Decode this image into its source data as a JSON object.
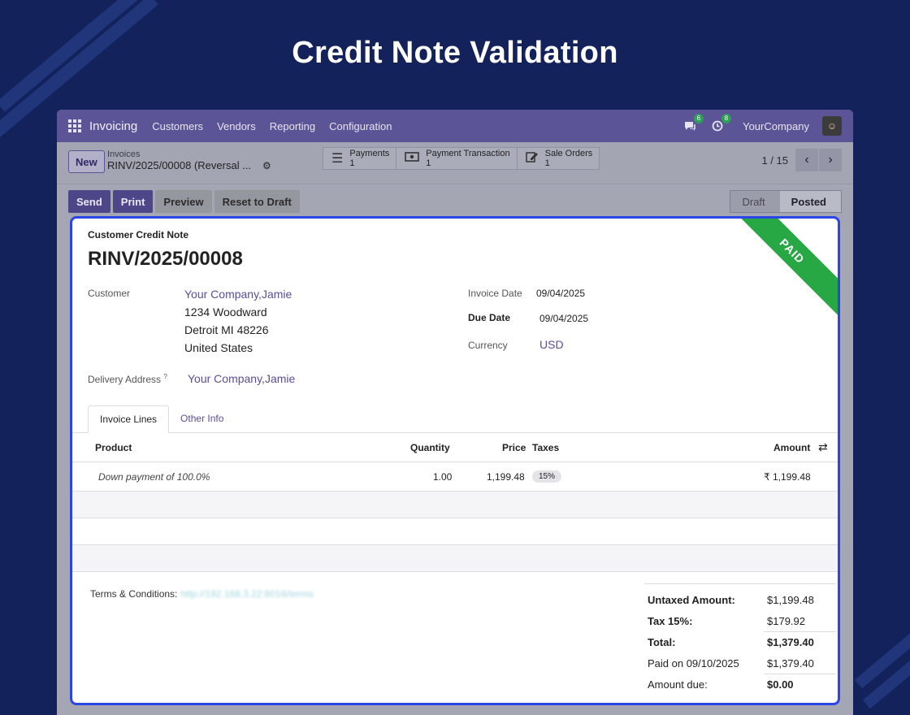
{
  "banner": {
    "title": "Credit Note Validation"
  },
  "navbar": {
    "app_name": "Invoicing",
    "menu": [
      "Customers",
      "Vendors",
      "Reporting",
      "Configuration"
    ],
    "messages_count": "6",
    "activities_count": "8",
    "company": "YourCompany"
  },
  "control": {
    "new_label": "New",
    "breadcrumb_parent": "Invoices",
    "breadcrumb_current": "RINV/2025/00008 (Reversal ...",
    "smart_buttons": [
      {
        "label": "Payments",
        "count": "1",
        "icon": "list-icon"
      },
      {
        "label": "Payment Transaction",
        "count": "1",
        "icon": "money-icon"
      },
      {
        "label": "Sale Orders",
        "count": "1",
        "icon": "edit-icon"
      }
    ],
    "pager": "1 / 15"
  },
  "actions": {
    "send": "Send",
    "print": "Print",
    "preview": "Preview",
    "reset": "Reset to Draft"
  },
  "status": {
    "draft": "Draft",
    "posted": "Posted",
    "current": "Posted"
  },
  "form": {
    "ribbon": "PAID",
    "doc_type": "Customer Credit Note",
    "number": "RINV/2025/00008",
    "customer_label": "Customer",
    "customer_name": "Your Company,Jamie",
    "address_line1": "1234 Woodward",
    "address_line2": "Detroit MI 48226",
    "address_line3": "United States",
    "delivery_label": "Delivery Address",
    "delivery_help": "?",
    "delivery_value": "Your Company,Jamie",
    "invoice_date_label": "Invoice Date",
    "invoice_date": "09/04/2025",
    "due_date_label": "Due Date",
    "due_date": "09/04/2025",
    "currency_label": "Currency",
    "currency": "USD"
  },
  "tabs": [
    "Invoice Lines",
    "Other Info"
  ],
  "lines": {
    "headers": {
      "product": "Product",
      "quantity": "Quantity",
      "price": "Price",
      "taxes": "Taxes",
      "amount": "Amount"
    },
    "rows": [
      {
        "product": "Down payment of 100.0%",
        "quantity": "1.00",
        "price": "1,199.48",
        "tax": "15%",
        "amount": "₹ 1,199.48"
      }
    ]
  },
  "terms": {
    "label": "Terms & Conditions:",
    "link": "http://192.168.3.22:8016/terms"
  },
  "totals": {
    "untaxed_label": "Untaxed Amount:",
    "untaxed": "$1,199.48",
    "tax_label": "Tax 15%:",
    "tax": "$179.92",
    "total_label": "Total:",
    "total": "$1,379.40",
    "paid_label": "Paid on 09/10/2025",
    "paid": "$1,379.40",
    "due_label": "Amount due:",
    "due": "$0.00"
  }
}
